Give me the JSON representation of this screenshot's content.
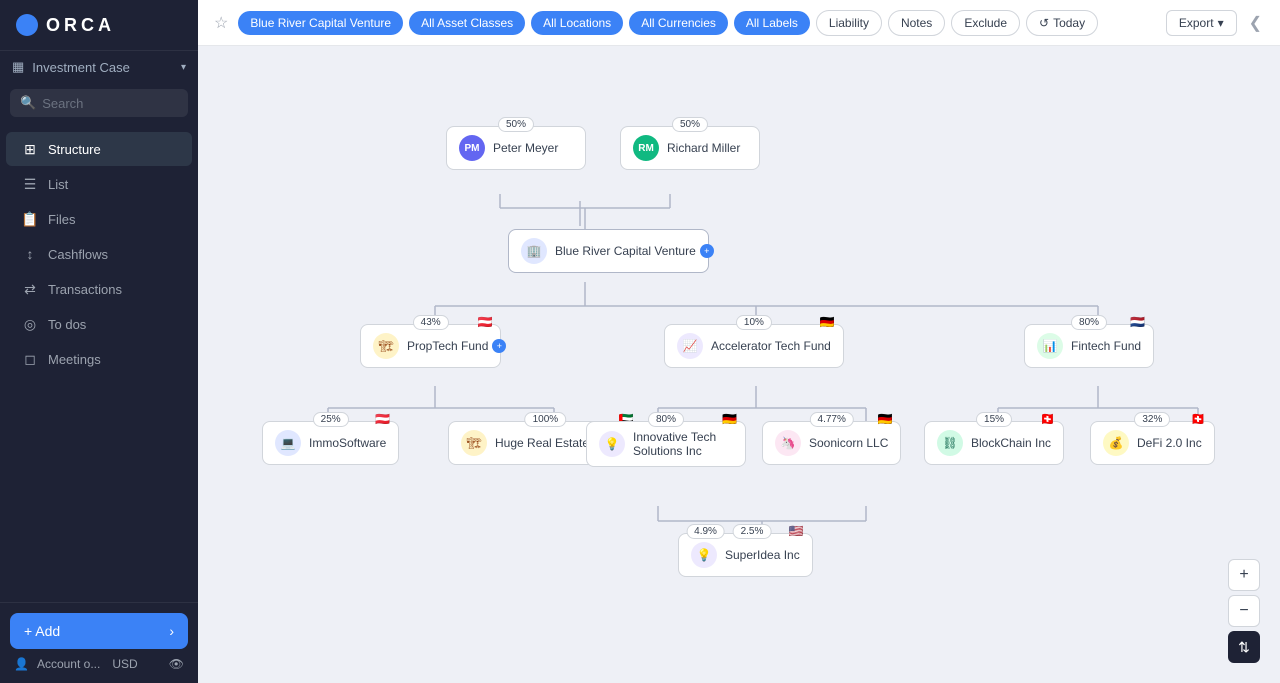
{
  "app": {
    "logo": "ORCA",
    "logo_icon": "●"
  },
  "sidebar": {
    "investment_case": "Investment Case",
    "search_placeholder": "Search",
    "nav_items": [
      {
        "id": "structure",
        "label": "Structure",
        "icon": "⊞",
        "active": true
      },
      {
        "id": "list",
        "label": "List",
        "icon": "≡",
        "active": false
      },
      {
        "id": "files",
        "label": "Files",
        "icon": "📄",
        "active": false
      },
      {
        "id": "cashflows",
        "label": "Cashflows",
        "icon": "↕",
        "active": false
      },
      {
        "id": "transactions",
        "label": "Transactions",
        "icon": "⇄",
        "active": false
      },
      {
        "id": "todos",
        "label": "To dos",
        "icon": "◎",
        "active": false
      },
      {
        "id": "meetings",
        "label": "Meetings",
        "icon": "◻",
        "active": false
      }
    ],
    "add_label": "Add",
    "account_label": "Account o...",
    "currency": "USD"
  },
  "toolbar": {
    "star_icon": "★",
    "chips": [
      {
        "id": "fund",
        "label": "Blue River Capital Venture",
        "active": true
      },
      {
        "id": "asset",
        "label": "All Asset Classes",
        "active": true
      },
      {
        "id": "location",
        "label": "All Locations",
        "active": true
      },
      {
        "id": "currency",
        "label": "All Currencies",
        "active": true
      },
      {
        "id": "labels",
        "label": "All Labels",
        "active": true
      },
      {
        "id": "liability",
        "label": "Liability",
        "active": false
      },
      {
        "id": "notes",
        "label": "Notes",
        "active": false
      },
      {
        "id": "exclude",
        "label": "Exclude",
        "active": false
      },
      {
        "id": "today",
        "label": "Today",
        "active": false
      }
    ],
    "export_label": "Export",
    "collapse_icon": "❮"
  },
  "tree": {
    "persons": [
      {
        "id": "pm",
        "initials": "PM",
        "name": "Peter Meyer",
        "percent": "50%",
        "color": "#6366f1"
      },
      {
        "id": "rm",
        "initials": "RM",
        "name": "Richard Miller",
        "percent": "50%",
        "color": "#10b981"
      }
    ],
    "root": {
      "id": "brcv",
      "name": "Blue River Capital Venture",
      "icon": "🏢"
    },
    "level2": [
      {
        "id": "proptech",
        "name": "PropTech Fund",
        "percent": "43%",
        "flag": "🇦🇹",
        "icon": "🏗",
        "add": true
      },
      {
        "id": "accel",
        "name": "Accelerator Tech Fund",
        "percent": "10%",
        "flag": "🇩🇪",
        "icon": "📈",
        "add": false
      },
      {
        "id": "fintech",
        "name": "Fintech Fund",
        "percent": "80%",
        "flag": "🇳🇱",
        "icon": "📊",
        "add": false
      }
    ],
    "level3": [
      {
        "id": "immo",
        "name": "ImmoSoftware",
        "percent": "25%",
        "flag": "🇦🇹",
        "icon": "💻"
      },
      {
        "id": "hugere",
        "name": "Huge Real Estate Project",
        "percent": "100%",
        "flag": "🇦🇪",
        "icon": "🏗"
      },
      {
        "id": "innovative",
        "name": "Innovative Tech Solutions Inc",
        "percent": "80%",
        "flag": "🇩🇪",
        "icon": "💡"
      },
      {
        "id": "soonicorn",
        "name": "Soonicorn LLC",
        "percent": "4.77%",
        "flag": "🇩🇪",
        "icon": "🦄"
      },
      {
        "id": "blockchain",
        "name": "BlockChain Inc",
        "percent": "15%",
        "flag": "🇨🇭",
        "icon": "⛓"
      },
      {
        "id": "defi",
        "name": "DeFi 2.0 Inc",
        "percent": "32%",
        "flag": "🇨🇭",
        "icon": "💰"
      }
    ],
    "level4": [
      {
        "id": "superidea",
        "name": "SuperIdea Inc",
        "percent1": "4.9%",
        "percent2": "2.5%",
        "flag": "🇺🇸",
        "icon": "💡"
      }
    ]
  },
  "zoom": {
    "plus": "+",
    "minus": "−",
    "settings": "⇅"
  }
}
